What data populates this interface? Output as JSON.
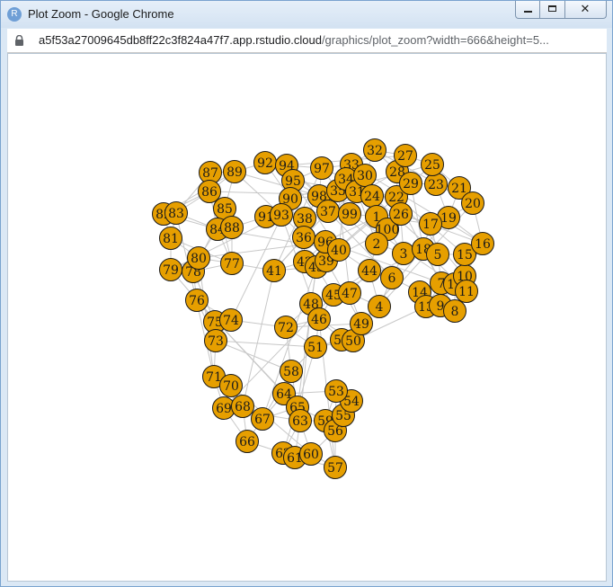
{
  "window": {
    "title": "Plot Zoom - Google Chrome",
    "app_icon_letter": "R",
    "controls": {
      "minimize": "minimize",
      "maximize": "maximize",
      "close": "✕"
    }
  },
  "address_bar": {
    "url_host": "a5f53a27009645db8ff22c3f824a47f7.app.rstudio.cloud",
    "url_rest": "/graphics/plot_zoom?width=666&height=5..."
  },
  "plot": {
    "node_color": "#E69F00",
    "edge_color": "#C8C8C8",
    "node_labels": [
      "1",
      "2",
      "3",
      "4",
      "5",
      "6",
      "7",
      "8",
      "9",
      "10",
      "11",
      "12",
      "13",
      "14",
      "15",
      "16",
      "17",
      "18",
      "19",
      "20",
      "21",
      "22",
      "23",
      "24",
      "25",
      "26",
      "27",
      "28",
      "29",
      "30",
      "31",
      "32",
      "33",
      "34",
      "35",
      "36",
      "37",
      "38",
      "39",
      "40",
      "41",
      "42",
      "43",
      "44",
      "45",
      "46",
      "47",
      "48",
      "49",
      "50",
      "51",
      "52",
      "53",
      "54",
      "55",
      "56",
      "57",
      "58",
      "59",
      "60",
      "61",
      "62",
      "63",
      "64",
      "65",
      "66",
      "67",
      "68",
      "69",
      "70",
      "71",
      "72",
      "73",
      "74",
      "75",
      "76",
      "77",
      "78",
      "79",
      "80",
      "81",
      "82",
      "83",
      "84",
      "85",
      "86",
      "87",
      "88",
      "89",
      "90",
      "91",
      "92",
      "93",
      "94",
      "95",
      "96",
      "97",
      "98",
      "99",
      "100"
    ]
  }
}
